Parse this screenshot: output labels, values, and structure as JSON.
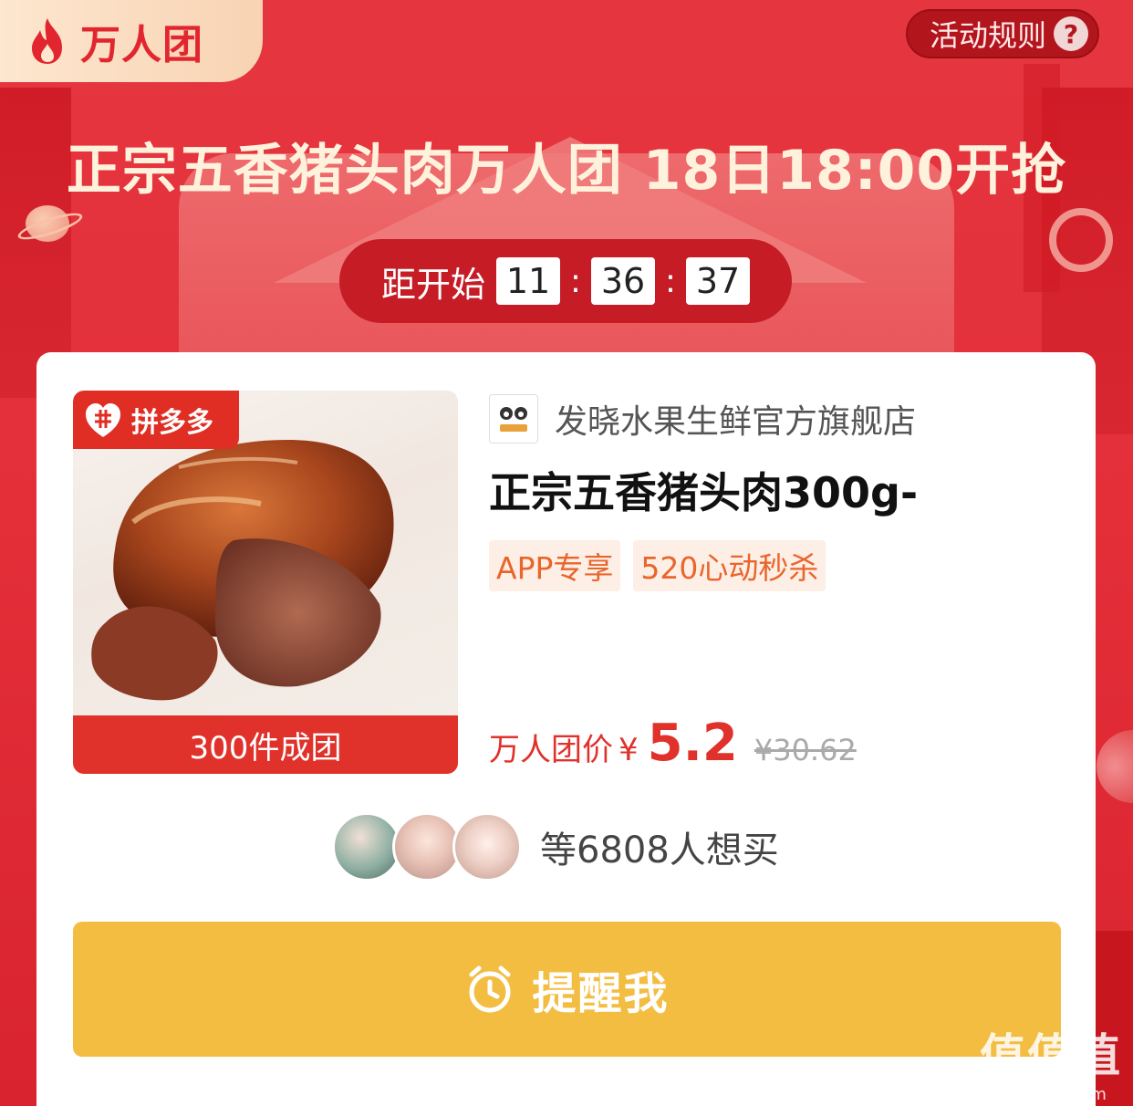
{
  "badge": {
    "label": "万人团"
  },
  "rules": {
    "label": "活动规则",
    "icon": "?"
  },
  "headline": "正宗五香猪头肉万人团 18日18:00开抢",
  "countdown": {
    "label": "距开始",
    "hours": "11",
    "minutes": "36",
    "seconds": "37",
    "separator": ":"
  },
  "product": {
    "platform_tag": "拼多多",
    "group_threshold": "300件成团",
    "shop_name": "发晓水果生鲜官方旗舰店",
    "title": "正宗五香猪头肉300g-",
    "tags": [
      "APP专享",
      "520心动秒杀"
    ],
    "price_label": "万人团价",
    "currency": "¥",
    "price": "5.2",
    "original_price": "¥30.62"
  },
  "buyers": {
    "text": "等6808人想买"
  },
  "remind": {
    "label": "提醒我"
  },
  "watermark": {
    "big": "值值值",
    "small": "zhizhizhi.com"
  },
  "colors": {
    "bg_red": "#e42f39",
    "accent_red": "#e0322b",
    "remind_yellow": "#f3bd42",
    "tag_orange": "#e9662b"
  }
}
